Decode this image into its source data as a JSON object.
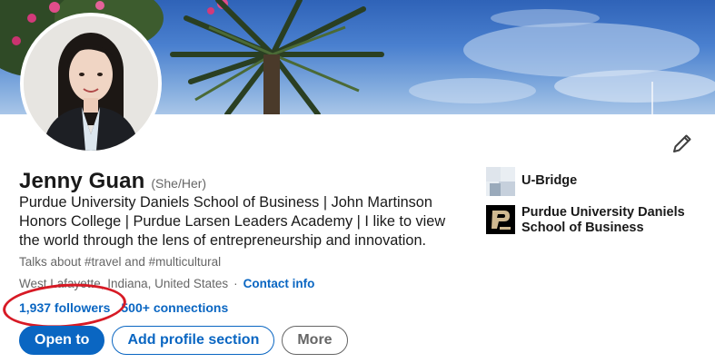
{
  "profile": {
    "name": "Jenny Guan",
    "pronouns": "(She/Her)",
    "headline": "Purdue University Daniels School of Business | John Martinson Honors College | Purdue Larsen Leaders Academy | I like to view the world through the lens of entrepreneurship and innovation.",
    "talks_about": "Talks about #travel and #multicultural",
    "location": "West Lafayette, Indiana, United States",
    "contact_info_label": "Contact info",
    "followers_label": "1,937 followers",
    "connections_label": "500+ connections"
  },
  "actions": {
    "open_to_label": "Open to",
    "add_section_label": "Add profile section",
    "more_label": "More"
  },
  "organizations": [
    {
      "name": "U-Bridge",
      "logo": "u-bridge-logo"
    },
    {
      "name": "Purdue University Daniels School of Business",
      "logo": "purdue-logo"
    }
  ],
  "annotation": {
    "color": "#d71a25",
    "target": "followers"
  },
  "colors": {
    "link": "#0a66c2",
    "primary_button": "#0a66c2",
    "secondary_text": "#666666"
  },
  "icons": {
    "edit": "pencil-icon"
  }
}
